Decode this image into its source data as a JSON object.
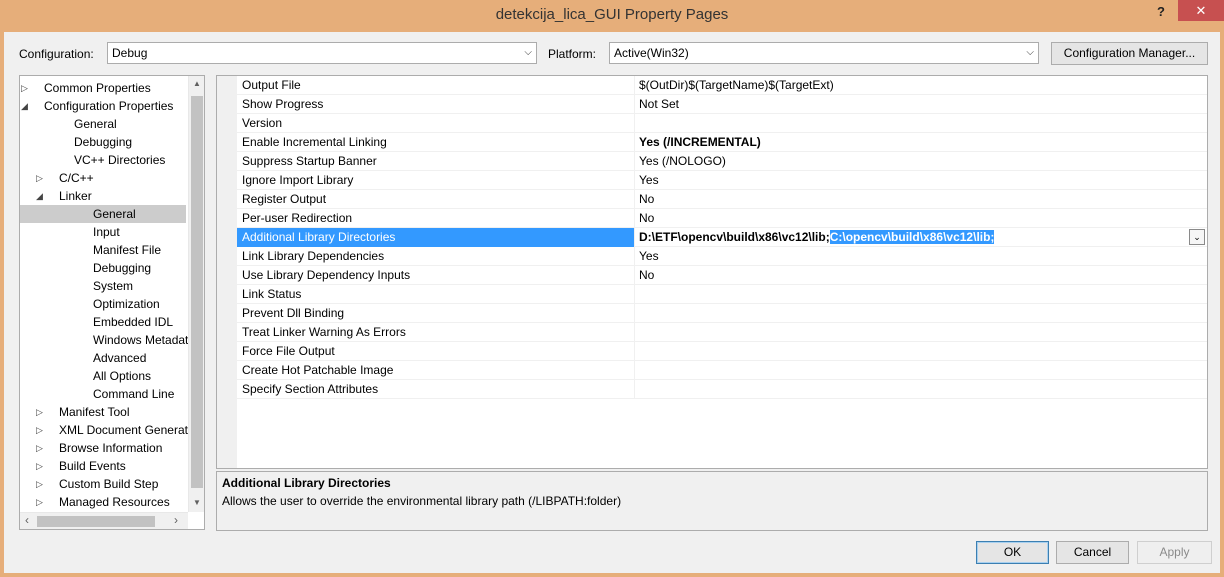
{
  "window": {
    "title": "detekcija_lica_GUI Property Pages",
    "help_label": "?",
    "close_label": "✕"
  },
  "toolbar": {
    "configuration_label": "Configuration:",
    "configuration_value": "Debug",
    "platform_label": "Platform:",
    "platform_value": "Active(Win32)",
    "config_manager_label": "Configuration Manager..."
  },
  "tree": {
    "items": [
      {
        "label": "Common Properties",
        "toggle": "▷"
      },
      {
        "label": "Configuration Properties",
        "toggle": "◢"
      },
      {
        "label": "General",
        "toggle": ""
      },
      {
        "label": "Debugging",
        "toggle": ""
      },
      {
        "label": "VC++ Directories",
        "toggle": ""
      },
      {
        "label": "C/C++",
        "toggle": "▷"
      },
      {
        "label": "Linker",
        "toggle": "◢"
      },
      {
        "label": "General",
        "toggle": ""
      },
      {
        "label": "Input",
        "toggle": ""
      },
      {
        "label": "Manifest File",
        "toggle": ""
      },
      {
        "label": "Debugging",
        "toggle": ""
      },
      {
        "label": "System",
        "toggle": ""
      },
      {
        "label": "Optimization",
        "toggle": ""
      },
      {
        "label": "Embedded IDL",
        "toggle": ""
      },
      {
        "label": "Windows Metadata",
        "toggle": ""
      },
      {
        "label": "Advanced",
        "toggle": ""
      },
      {
        "label": "All Options",
        "toggle": ""
      },
      {
        "label": "Command Line",
        "toggle": ""
      },
      {
        "label": "Manifest Tool",
        "toggle": "▷"
      },
      {
        "label": "XML Document Generator",
        "toggle": "▷"
      },
      {
        "label": "Browse Information",
        "toggle": "▷"
      },
      {
        "label": "Build Events",
        "toggle": "▷"
      },
      {
        "label": "Custom Build Step",
        "toggle": "▷"
      },
      {
        "label": "Managed Resources",
        "toggle": "▷"
      }
    ],
    "selected_index": 7
  },
  "properties": [
    {
      "name": "Output File",
      "value": "$(OutDir)$(TargetName)$(TargetExt)"
    },
    {
      "name": "Show Progress",
      "value": "Not Set"
    },
    {
      "name": "Version",
      "value": ""
    },
    {
      "name": "Enable Incremental Linking",
      "value": "Yes (/INCREMENTAL)"
    },
    {
      "name": "Suppress Startup Banner",
      "value": "Yes (/NOLOGO)"
    },
    {
      "name": "Ignore Import Library",
      "value": "Yes"
    },
    {
      "name": "Register Output",
      "value": "No"
    },
    {
      "name": "Per-user Redirection",
      "value": "No"
    },
    {
      "name": "Additional Library Directories",
      "value": "D:\\ETF\\opencv\\build\\x86\\vc12\\lib;",
      "value_selected": "C:\\opencv\\build\\x86\\vc12\\lib;"
    },
    {
      "name": "Link Library Dependencies",
      "value": "Yes"
    },
    {
      "name": "Use Library Dependency Inputs",
      "value": "No"
    },
    {
      "name": "Link Status",
      "value": ""
    },
    {
      "name": "Prevent Dll Binding",
      "value": ""
    },
    {
      "name": "Treat Linker Warning As Errors",
      "value": ""
    },
    {
      "name": "Force File Output",
      "value": ""
    },
    {
      "name": "Create Hot Patchable Image",
      "value": ""
    },
    {
      "name": "Specify Section Attributes",
      "value": ""
    }
  ],
  "description": {
    "title": "Additional Library Directories",
    "text": "Allows the user to override the environmental library path (/LIBPATH:folder)"
  },
  "buttons": {
    "ok": "OK",
    "cancel": "Cancel",
    "apply": "Apply"
  },
  "colors": {
    "title_bar": "#e6ae7a",
    "selection": "#3399ff",
    "close_button": "#c75050"
  }
}
